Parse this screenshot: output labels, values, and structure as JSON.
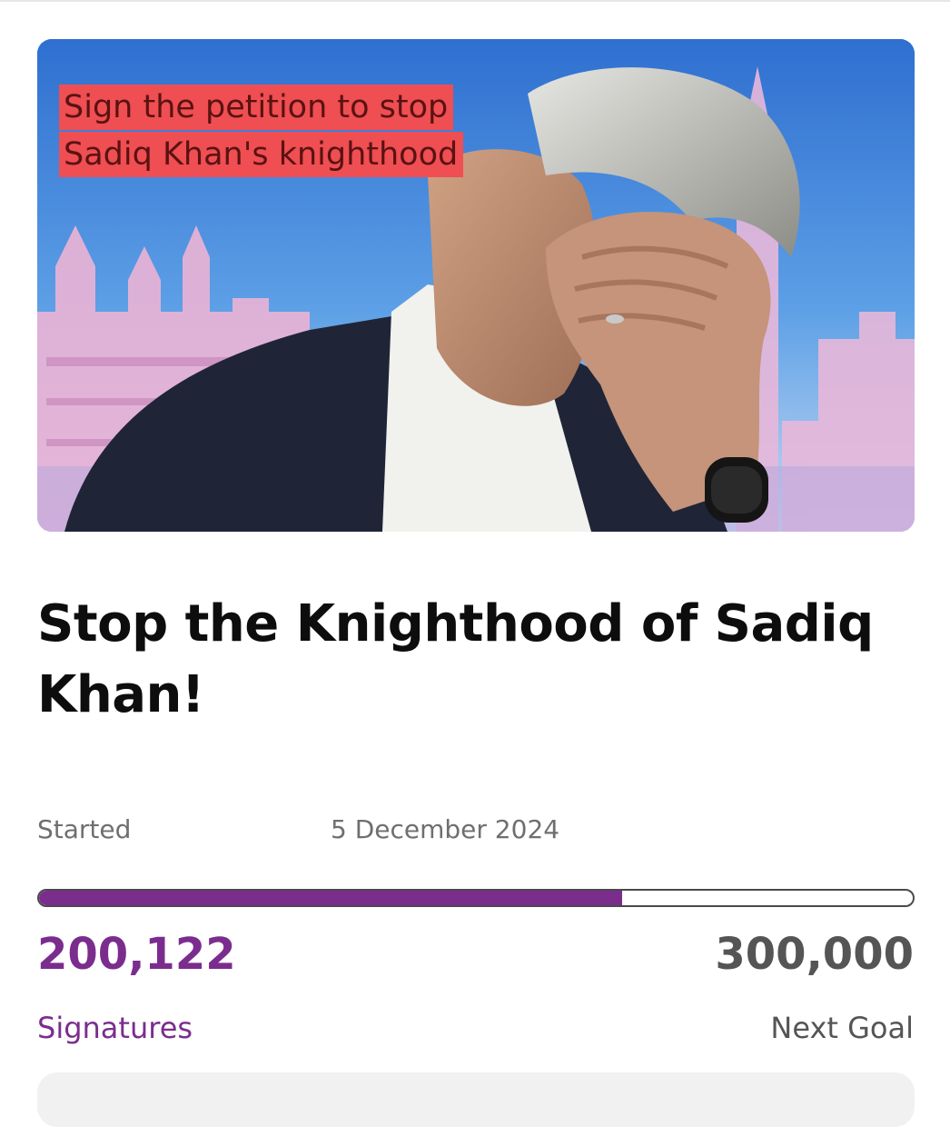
{
  "hero": {
    "caption_line1": "Sign the petition to stop",
    "caption_line2": "Sadiq Khan's knighthood"
  },
  "petition": {
    "title": "Stop the Knighthood of Sadiq Khan!",
    "started_label": "Started",
    "started_date": "5 December 2024"
  },
  "progress": {
    "signatures": "200,122",
    "signatures_label": "Signatures",
    "goal": "300,000",
    "goal_label": "Next Goal",
    "fraction": 0.667
  },
  "colors": {
    "accent": "#7b2d8e",
    "caption_bg": "#ef4e52",
    "muted": "#6f6f6f"
  }
}
